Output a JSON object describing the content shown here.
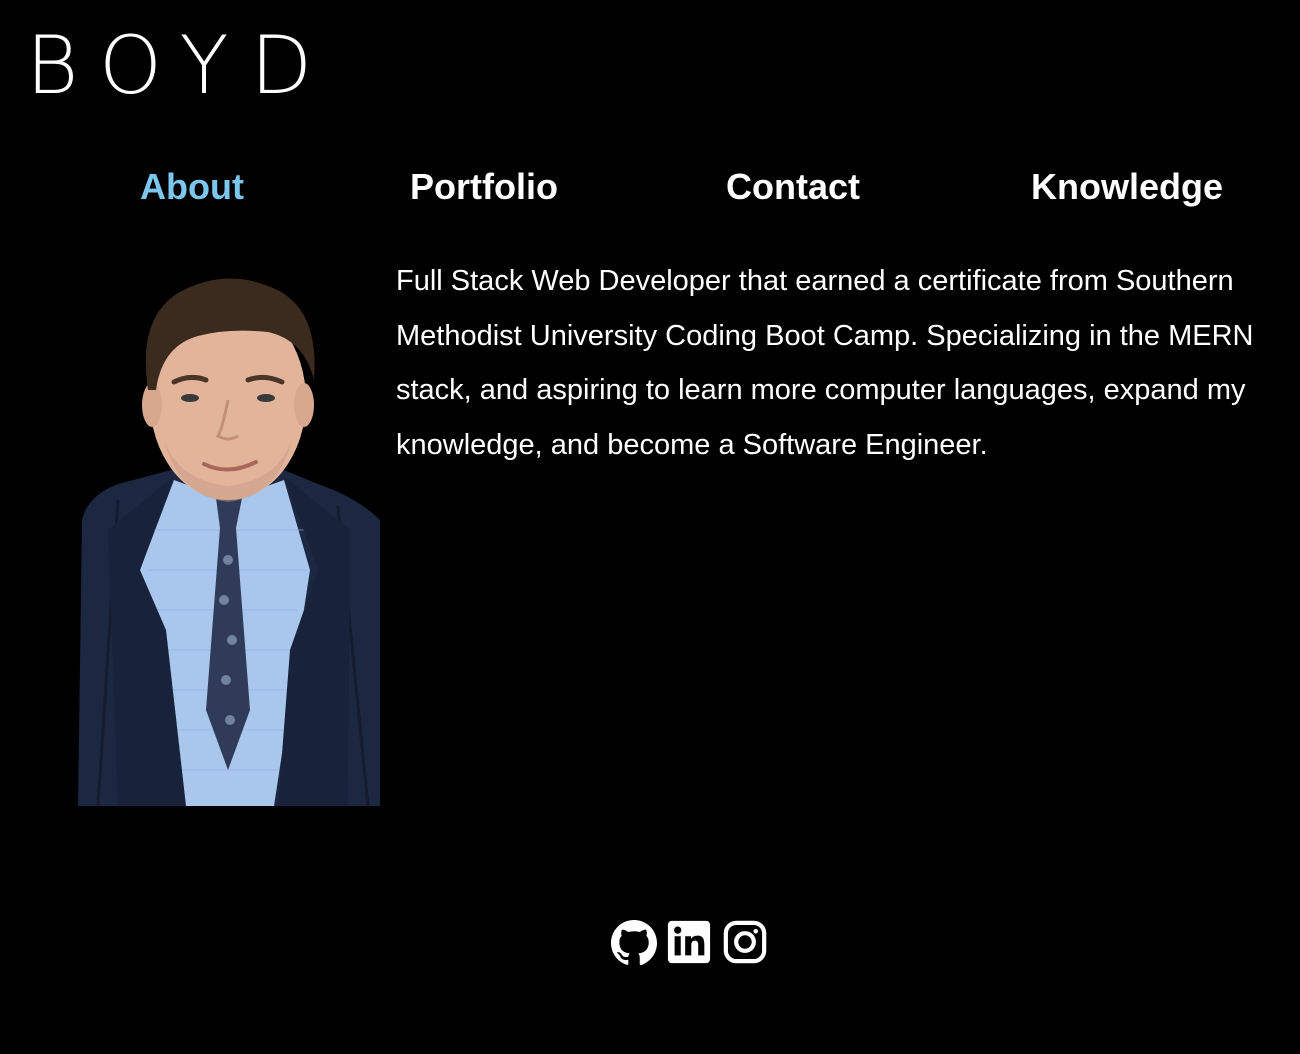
{
  "header": {
    "logo_text": "BOYD"
  },
  "nav": {
    "items": [
      {
        "label": "About",
        "active": true
      },
      {
        "label": "Portfolio",
        "active": false
      },
      {
        "label": "Contact",
        "active": false
      },
      {
        "label": "Knowledge",
        "active": false
      }
    ],
    "active_color": "#7cc7ee"
  },
  "about": {
    "bio": "Full Stack Web Developer that earned a certificate from Southern Methodist University Coding Boot Camp. Specializing in the MERN stack, and aspiring to learn more computer languages, expand my knowledge, and become a Software Engineer."
  },
  "footer": {
    "social_icons": [
      "github-icon",
      "linkedin-icon",
      "instagram-icon"
    ]
  },
  "colors": {
    "background": "#000000",
    "text": "#ffffff",
    "accent": "#7cc7ee"
  }
}
